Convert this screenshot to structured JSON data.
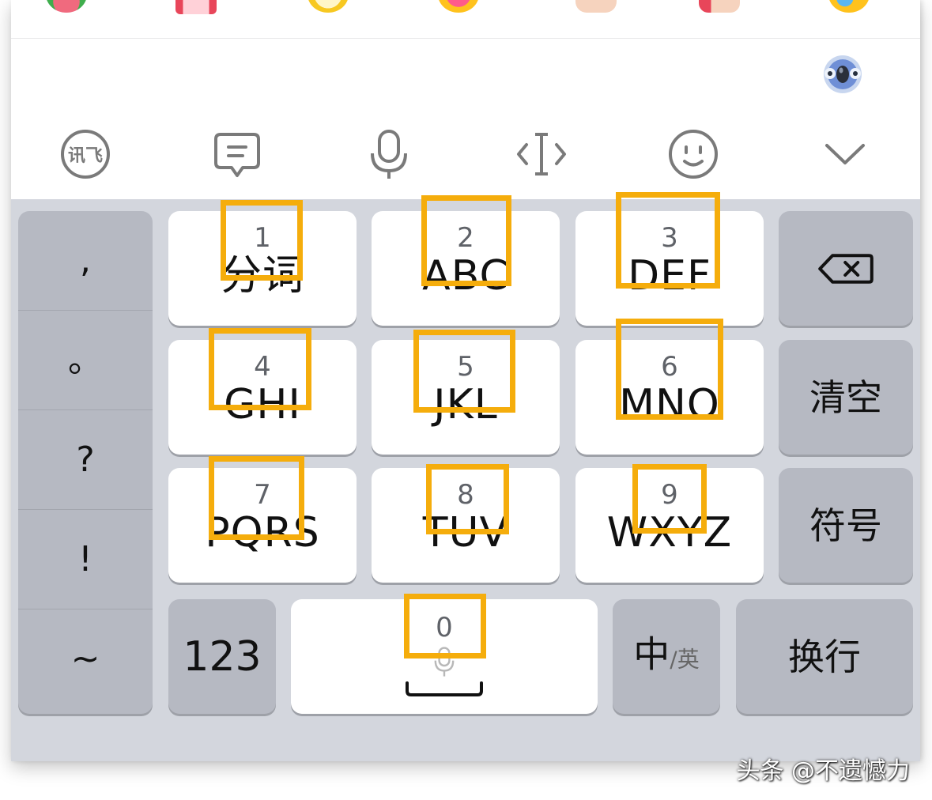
{
  "emoji_strip": {
    "items": [
      "watermelon-emoji",
      "gift-emoji",
      "yellow-face-emoji",
      "pink-face-emoji",
      "hand-emoji",
      "thumb-emoji",
      "laughing-face-emoji"
    ]
  },
  "toolbar": {
    "items": [
      "iflytek-logo-icon",
      "chat-bubble-icon",
      "microphone-icon",
      "cursor-move-icon",
      "smiley-icon",
      "collapse-chevron-icon"
    ],
    "iflytek_text": "讯飞"
  },
  "keyboard": {
    "punctuation": [
      ",",
      "。",
      "?",
      "!",
      "~"
    ],
    "keys": [
      {
        "num": "1",
        "letters": "分词"
      },
      {
        "num": "2",
        "letters": "ABC"
      },
      {
        "num": "3",
        "letters": "DEF"
      },
      {
        "num": "4",
        "letters": "GHI"
      },
      {
        "num": "5",
        "letters": "JKL"
      },
      {
        "num": "6",
        "letters": "MNO"
      },
      {
        "num": "7",
        "letters": "PQRS"
      },
      {
        "num": "8",
        "letters": "TUV"
      },
      {
        "num": "9",
        "letters": "WXYZ"
      }
    ],
    "clear_label": "清空",
    "symbol_label": "符号",
    "numeric_label": "123",
    "space_num": "0",
    "lang_main": "中",
    "lang_sub": "/英",
    "enter_label": "换行"
  },
  "colors": {
    "highlight": "#f5ad0c",
    "keyboard_bg": "#d3d6dd",
    "key_white": "#ffffff",
    "key_gray": "#b6b9c2"
  },
  "watermark": "头条 @不遗憾力"
}
